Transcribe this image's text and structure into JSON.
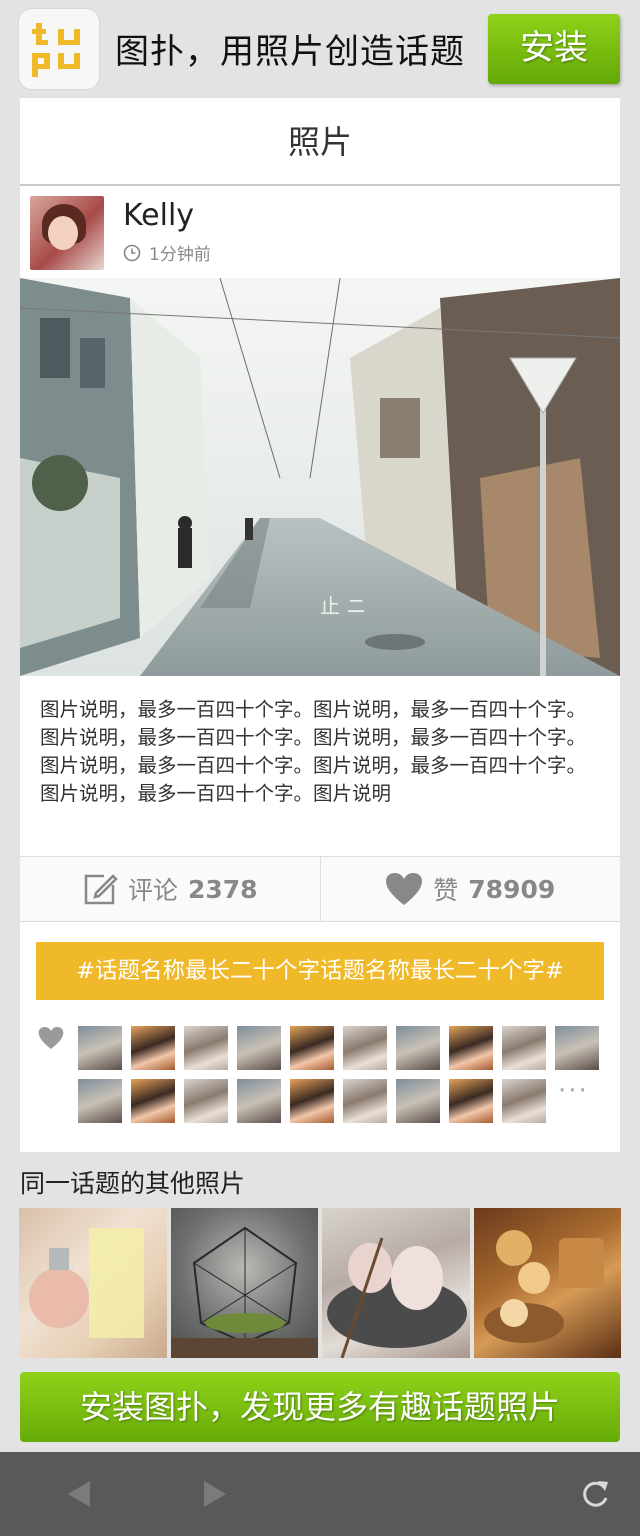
{
  "banner": {
    "logo_text": "tupu",
    "title": "图扑，用照片创造话题",
    "install_label": "安装"
  },
  "card": {
    "header_title": "照片",
    "post": {
      "username": "Kelly",
      "time": "1分钟前",
      "caption": "图片说明，最多一百四十个字。图片说明，最多一百四十个字。图片说明，最多一百四十个字。图片说明，最多一百四十个字。图片说明，最多一百四十个字。图片说明，最多一百四十个字。图片说明，最多一百四十个字。图片说明"
    },
    "actions": {
      "comment_label": "评论",
      "comment_count": "2378",
      "like_label": "赞",
      "like_count": "78909"
    },
    "topic": "#话题名称最长二十个字话题名称最长二十个字#",
    "likers_more": "···"
  },
  "related": {
    "title": "同一话题的其他照片"
  },
  "cta_label": "安装图扑，发现更多有趣话题照片",
  "colors": {
    "accent_green": "#7cc012",
    "topic_yellow": "#f0b92a",
    "browser_bar": "#58595b"
  },
  "icons": [
    "clock-icon",
    "edit-icon",
    "heart-icon",
    "back-arrow-icon",
    "forward-arrow-icon",
    "refresh-icon"
  ]
}
